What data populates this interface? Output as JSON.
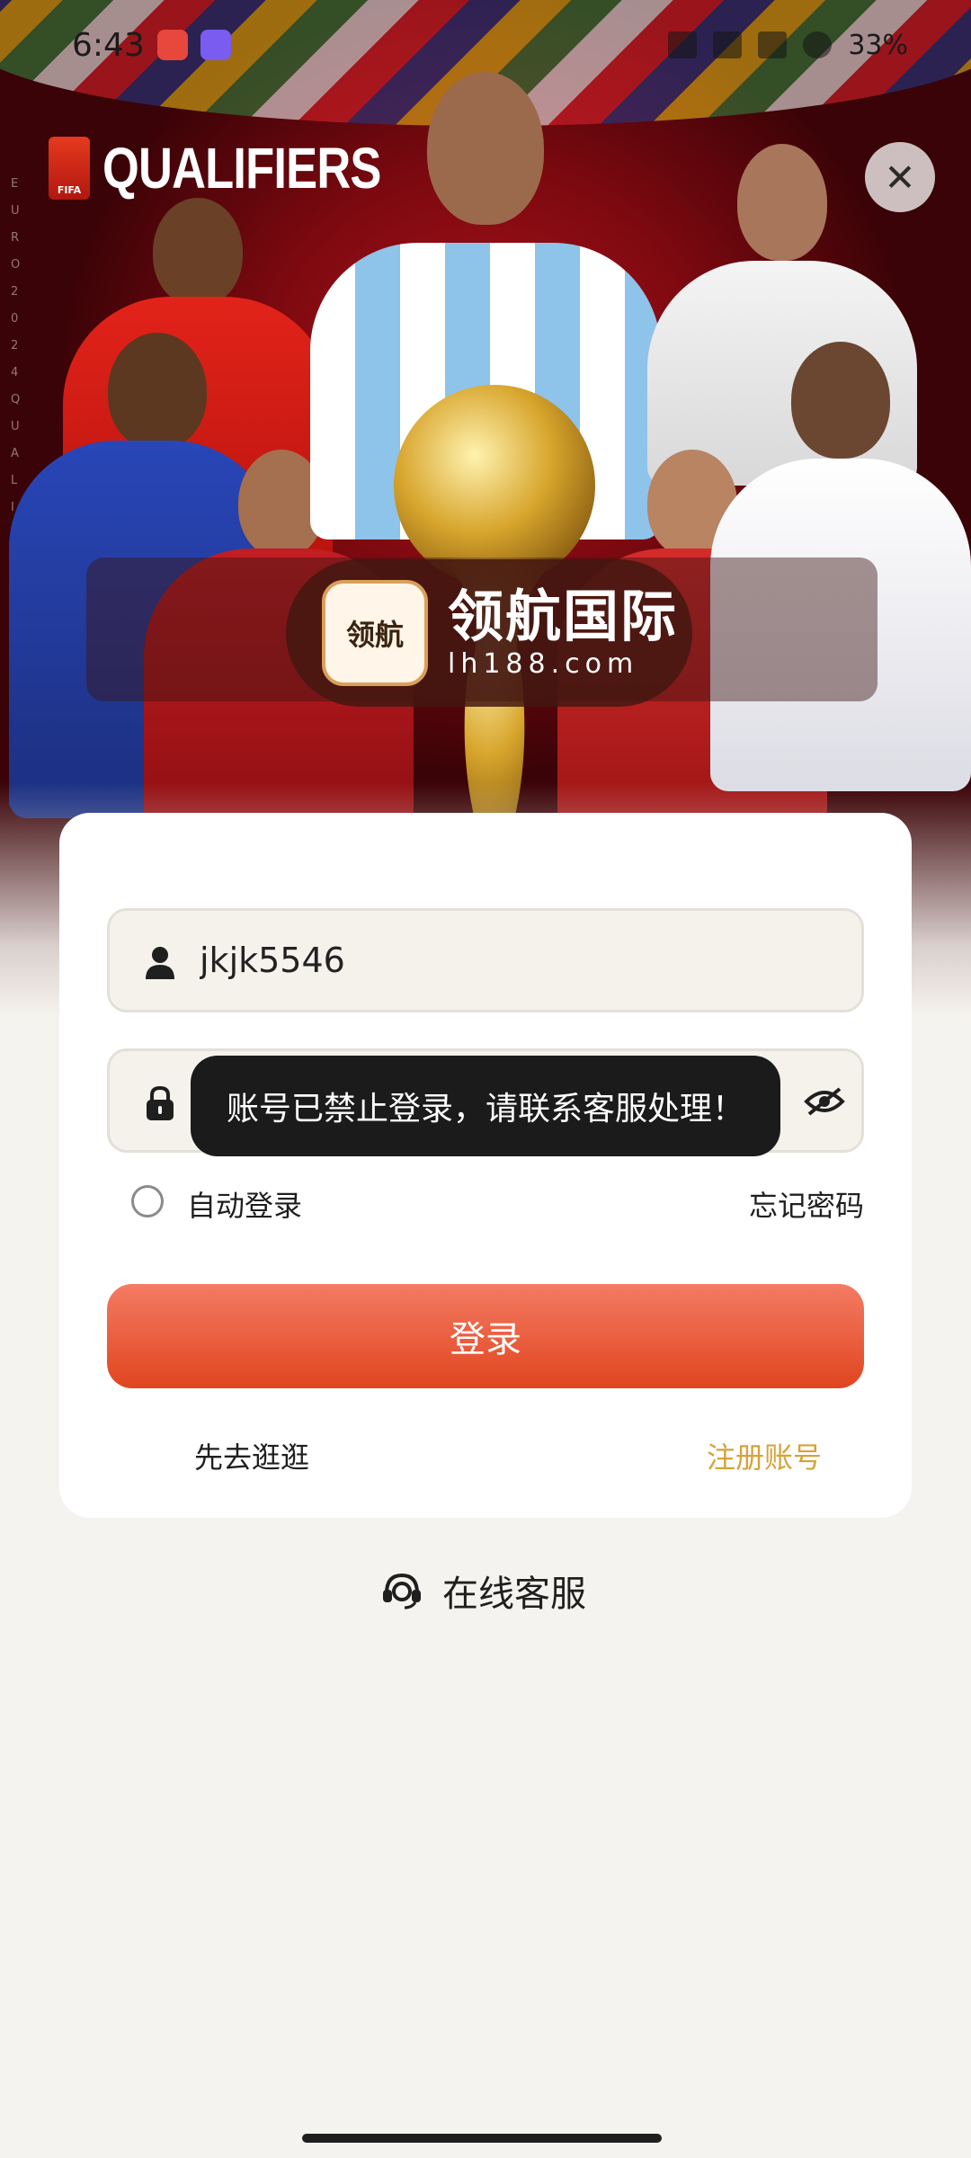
{
  "status_bar": {
    "time": "6:43",
    "battery": "33%"
  },
  "hero": {
    "brand_text": "QUALIFIERS",
    "emblem_text": "FIFA",
    "side_text": "EURO 2024 QUALIFIERS FINALS",
    "logo_badge": "领航",
    "logo_cn": "领航国际",
    "logo_url": "lh188.com"
  },
  "login": {
    "username_value": "jkjk5546",
    "auto_login_label": "自动登录",
    "forgot_password": "忘记密码",
    "login_button": "登录",
    "browse_link": "先去逛逛",
    "register_link": "注册账号"
  },
  "toast": {
    "message": "账号已禁止登录，请联系客服处理！"
  },
  "service": {
    "label": "在线客服"
  },
  "colors": {
    "accent": "#e0451f",
    "register_link": "#d6a23b",
    "hero_bg": "#7c0910"
  }
}
